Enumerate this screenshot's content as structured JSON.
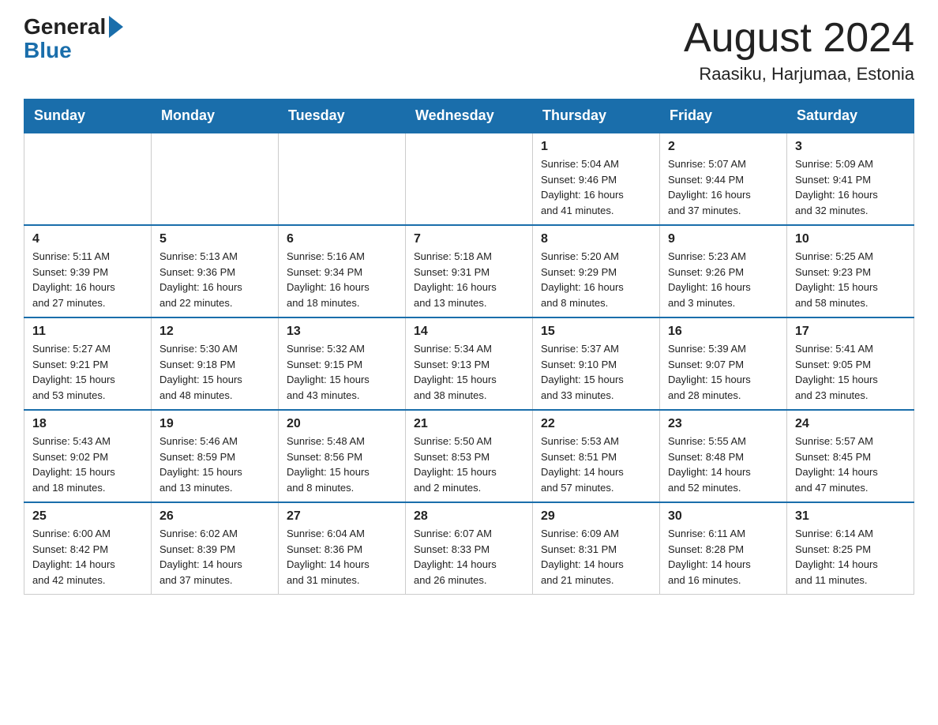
{
  "header": {
    "logo_general": "General",
    "logo_blue": "Blue",
    "month_year": "August 2024",
    "location": "Raasiku, Harjumaa, Estonia"
  },
  "weekdays": [
    "Sunday",
    "Monday",
    "Tuesday",
    "Wednesday",
    "Thursday",
    "Friday",
    "Saturday"
  ],
  "weeks": [
    [
      {
        "day": "",
        "info": ""
      },
      {
        "day": "",
        "info": ""
      },
      {
        "day": "",
        "info": ""
      },
      {
        "day": "",
        "info": ""
      },
      {
        "day": "1",
        "info": "Sunrise: 5:04 AM\nSunset: 9:46 PM\nDaylight: 16 hours\nand 41 minutes."
      },
      {
        "day": "2",
        "info": "Sunrise: 5:07 AM\nSunset: 9:44 PM\nDaylight: 16 hours\nand 37 minutes."
      },
      {
        "day": "3",
        "info": "Sunrise: 5:09 AM\nSunset: 9:41 PM\nDaylight: 16 hours\nand 32 minutes."
      }
    ],
    [
      {
        "day": "4",
        "info": "Sunrise: 5:11 AM\nSunset: 9:39 PM\nDaylight: 16 hours\nand 27 minutes."
      },
      {
        "day": "5",
        "info": "Sunrise: 5:13 AM\nSunset: 9:36 PM\nDaylight: 16 hours\nand 22 minutes."
      },
      {
        "day": "6",
        "info": "Sunrise: 5:16 AM\nSunset: 9:34 PM\nDaylight: 16 hours\nand 18 minutes."
      },
      {
        "day": "7",
        "info": "Sunrise: 5:18 AM\nSunset: 9:31 PM\nDaylight: 16 hours\nand 13 minutes."
      },
      {
        "day": "8",
        "info": "Sunrise: 5:20 AM\nSunset: 9:29 PM\nDaylight: 16 hours\nand 8 minutes."
      },
      {
        "day": "9",
        "info": "Sunrise: 5:23 AM\nSunset: 9:26 PM\nDaylight: 16 hours\nand 3 minutes."
      },
      {
        "day": "10",
        "info": "Sunrise: 5:25 AM\nSunset: 9:23 PM\nDaylight: 15 hours\nand 58 minutes."
      }
    ],
    [
      {
        "day": "11",
        "info": "Sunrise: 5:27 AM\nSunset: 9:21 PM\nDaylight: 15 hours\nand 53 minutes."
      },
      {
        "day": "12",
        "info": "Sunrise: 5:30 AM\nSunset: 9:18 PM\nDaylight: 15 hours\nand 48 minutes."
      },
      {
        "day": "13",
        "info": "Sunrise: 5:32 AM\nSunset: 9:15 PM\nDaylight: 15 hours\nand 43 minutes."
      },
      {
        "day": "14",
        "info": "Sunrise: 5:34 AM\nSunset: 9:13 PM\nDaylight: 15 hours\nand 38 minutes."
      },
      {
        "day": "15",
        "info": "Sunrise: 5:37 AM\nSunset: 9:10 PM\nDaylight: 15 hours\nand 33 minutes."
      },
      {
        "day": "16",
        "info": "Sunrise: 5:39 AM\nSunset: 9:07 PM\nDaylight: 15 hours\nand 28 minutes."
      },
      {
        "day": "17",
        "info": "Sunrise: 5:41 AM\nSunset: 9:05 PM\nDaylight: 15 hours\nand 23 minutes."
      }
    ],
    [
      {
        "day": "18",
        "info": "Sunrise: 5:43 AM\nSunset: 9:02 PM\nDaylight: 15 hours\nand 18 minutes."
      },
      {
        "day": "19",
        "info": "Sunrise: 5:46 AM\nSunset: 8:59 PM\nDaylight: 15 hours\nand 13 minutes."
      },
      {
        "day": "20",
        "info": "Sunrise: 5:48 AM\nSunset: 8:56 PM\nDaylight: 15 hours\nand 8 minutes."
      },
      {
        "day": "21",
        "info": "Sunrise: 5:50 AM\nSunset: 8:53 PM\nDaylight: 15 hours\nand 2 minutes."
      },
      {
        "day": "22",
        "info": "Sunrise: 5:53 AM\nSunset: 8:51 PM\nDaylight: 14 hours\nand 57 minutes."
      },
      {
        "day": "23",
        "info": "Sunrise: 5:55 AM\nSunset: 8:48 PM\nDaylight: 14 hours\nand 52 minutes."
      },
      {
        "day": "24",
        "info": "Sunrise: 5:57 AM\nSunset: 8:45 PM\nDaylight: 14 hours\nand 47 minutes."
      }
    ],
    [
      {
        "day": "25",
        "info": "Sunrise: 6:00 AM\nSunset: 8:42 PM\nDaylight: 14 hours\nand 42 minutes."
      },
      {
        "day": "26",
        "info": "Sunrise: 6:02 AM\nSunset: 8:39 PM\nDaylight: 14 hours\nand 37 minutes."
      },
      {
        "day": "27",
        "info": "Sunrise: 6:04 AM\nSunset: 8:36 PM\nDaylight: 14 hours\nand 31 minutes."
      },
      {
        "day": "28",
        "info": "Sunrise: 6:07 AM\nSunset: 8:33 PM\nDaylight: 14 hours\nand 26 minutes."
      },
      {
        "day": "29",
        "info": "Sunrise: 6:09 AM\nSunset: 8:31 PM\nDaylight: 14 hours\nand 21 minutes."
      },
      {
        "day": "30",
        "info": "Sunrise: 6:11 AM\nSunset: 8:28 PM\nDaylight: 14 hours\nand 16 minutes."
      },
      {
        "day": "31",
        "info": "Sunrise: 6:14 AM\nSunset: 8:25 PM\nDaylight: 14 hours\nand 11 minutes."
      }
    ]
  ]
}
